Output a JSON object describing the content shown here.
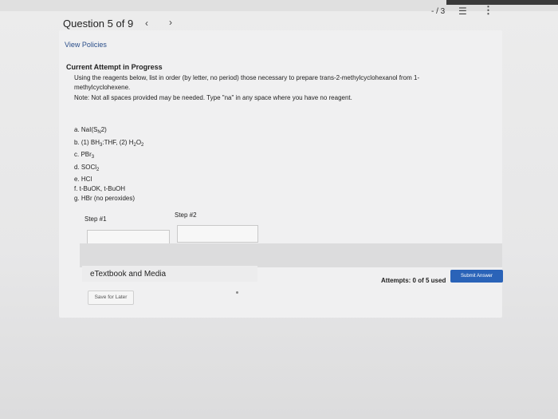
{
  "header": {
    "question_label": "Question 5 of 9",
    "prev_icon": "‹",
    "next_icon": "›",
    "score": "- / 3",
    "list_icon": "☰",
    "more_icon": "⋮"
  },
  "links": {
    "view_policies": "View Policies"
  },
  "question": {
    "attempt_title": "Current Attempt in Progress",
    "instruction_line1": "Using the reagents below, list in order (by letter, no period) those necessary to prepare trans-2-methylcyclohexanol from 1-",
    "instruction_line2": "methylcyclohexene.",
    "note": "Note: Not all spaces provided may be needed. Type \"na\" in any space where you have no reagent.",
    "reagents": {
      "a": {
        "prefix": "a. NaI(S",
        "sub": "N",
        "suffix": "2)"
      },
      "b": {
        "prefix": "b. (1) BH",
        "sub1": "3",
        "mid": ":THF, (2) H",
        "sub2": "2",
        "mid2": "O",
        "sub3": "2"
      },
      "c": {
        "prefix": "c. PBr",
        "sub": "3"
      },
      "d": {
        "prefix": "d. SOCl",
        "sub": "2"
      },
      "e": {
        "text": "e. HCl"
      },
      "f": {
        "text": "f. t-BuOK, t-BuOH"
      },
      "g": {
        "text": "g. HBr (no peroxides)"
      }
    },
    "steps": [
      {
        "label": "Step #1",
        "value": ""
      },
      {
        "label": "Step #2",
        "value": ""
      }
    ]
  },
  "footer": {
    "etextbook_label": "eTextbook and Media",
    "attempts_text": "Attempts: 0 of 5 used",
    "submit_label": "Submit Answer",
    "save_label": "Save for Later"
  }
}
